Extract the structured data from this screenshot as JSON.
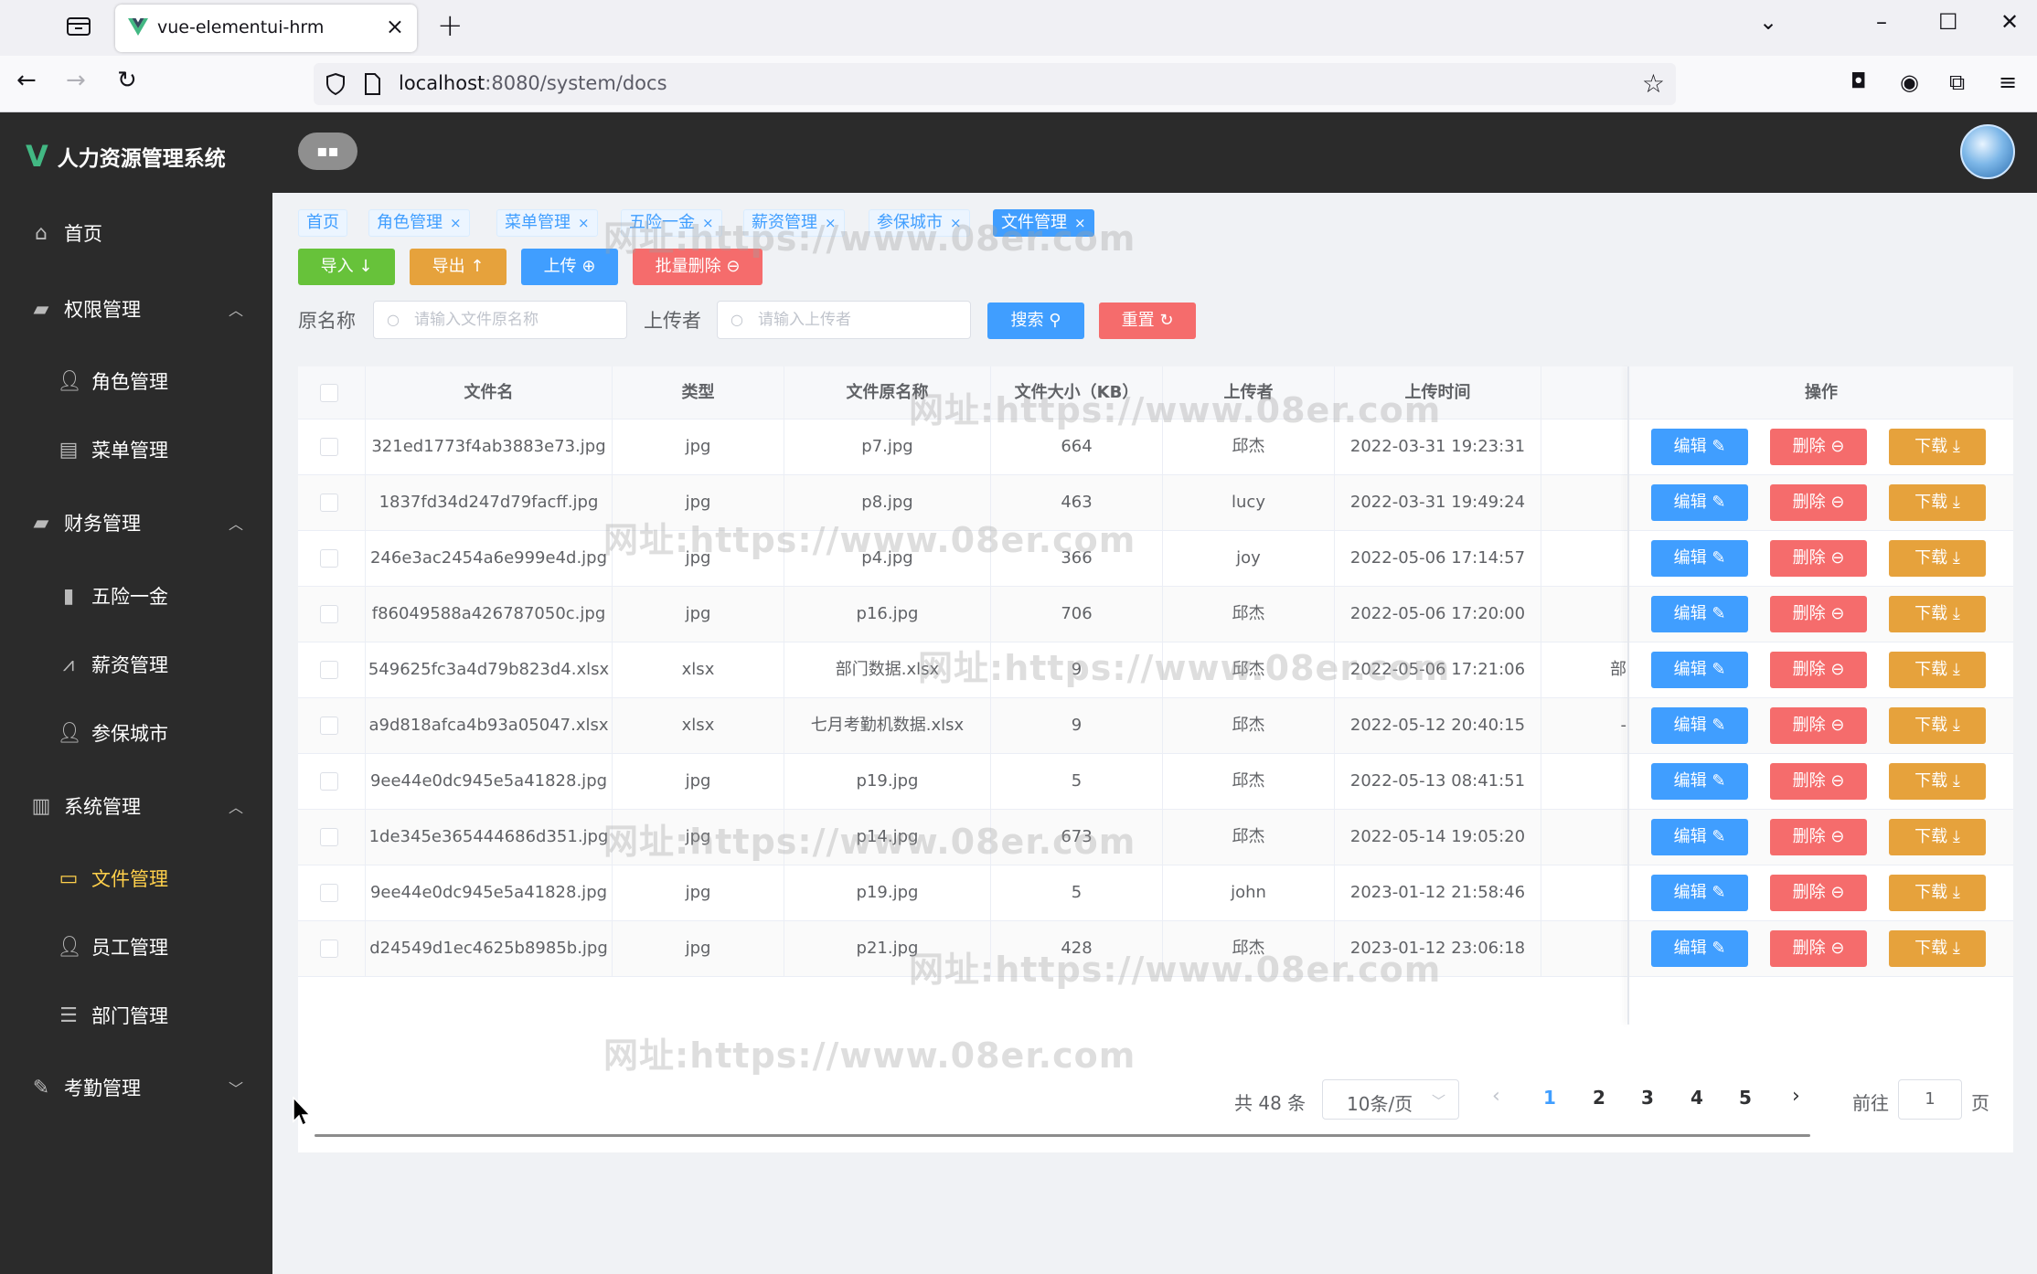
{
  "browser": {
    "tab_title": "vue-elementui-hrm",
    "url_host": "localhost",
    "url_rest": ":8080/system/docs"
  },
  "app": {
    "logo": "V",
    "title": "人力资源管理系统"
  },
  "sidebar": {
    "items": [
      {
        "label": "首页",
        "icon": "home-icon"
      },
      {
        "label": "权限管理",
        "icon": "briefcase-icon"
      },
      {
        "label": "角色管理",
        "icon": "user-icon"
      },
      {
        "label": "菜单管理",
        "icon": "document-icon"
      },
      {
        "label": "财务管理",
        "icon": "wallet-icon"
      },
      {
        "label": "五险一金",
        "icon": "bar-chart-icon"
      },
      {
        "label": "薪资管理",
        "icon": "line-chart-icon"
      },
      {
        "label": "参保城市",
        "icon": "user-icon"
      },
      {
        "label": "系统管理",
        "icon": "folder-icon"
      },
      {
        "label": "文件管理",
        "icon": "folder-open-icon"
      },
      {
        "label": "员工管理",
        "icon": "user-icon"
      },
      {
        "label": "部门管理",
        "icon": "sliders-icon"
      },
      {
        "label": "考勤管理",
        "icon": "edit-icon"
      }
    ]
  },
  "tags": [
    "首页",
    "角色管理",
    "菜单管理",
    "五险一金",
    "薪资管理",
    "参保城市",
    "文件管理"
  ],
  "toolbar": {
    "import": "导入 ↓",
    "export": "导出 ↑",
    "upload": "上传 ⊕",
    "batch_delete": "批量删除 ⊖"
  },
  "search": {
    "name_label": "原名称",
    "name_placeholder": "请输入文件原名称",
    "uploader_label": "上传者",
    "uploader_placeholder": "请输入上传者",
    "search_btn": "搜索 ",
    "reset_btn": "重置 ↻"
  },
  "table": {
    "columns": [
      "文件名",
      "类型",
      "文件原名称",
      "文件大小（KB）",
      "上传者",
      "上传时间",
      "操作"
    ],
    "rows": [
      {
        "name": "321ed1773f4ab3883e73.jpg",
        "type": "jpg",
        "orig": "p7.jpg",
        "size": "664",
        "uploader": "邱杰",
        "time": "2022-03-31 19:23:31",
        "extra": ""
      },
      {
        "name": "1837fd34d247d79facff.jpg",
        "type": "jpg",
        "orig": "p8.jpg",
        "size": "463",
        "uploader": "lucy",
        "time": "2022-03-31 19:49:24",
        "extra": ""
      },
      {
        "name": "246e3ac2454a6e999e4d.jpg",
        "type": "jpg",
        "orig": "p4.jpg",
        "size": "366",
        "uploader": "joy",
        "time": "2022-05-06 17:14:57",
        "extra": ""
      },
      {
        "name": "f86049588a426787050c.jpg",
        "type": "jpg",
        "orig": "p16.jpg",
        "size": "706",
        "uploader": "邱杰",
        "time": "2022-05-06 17:20:00",
        "extra": ""
      },
      {
        "name": "549625fc3a4d79b823d4.xlsx",
        "type": "xlsx",
        "orig": "部门数据.xlsx",
        "size": "9",
        "uploader": "邱杰",
        "time": "2022-05-06 17:21:06",
        "extra": "部"
      },
      {
        "name": "a9d818afca4b93a05047.xlsx",
        "type": "xlsx",
        "orig": "七月考勤机数据.xlsx",
        "size": "9",
        "uploader": "邱杰",
        "time": "2022-05-12 20:40:15",
        "extra": "-"
      },
      {
        "name": "9ee44e0dc945e5a41828.jpg",
        "type": "jpg",
        "orig": "p19.jpg",
        "size": "5",
        "uploader": "邱杰",
        "time": "2022-05-13 08:41:51",
        "extra": ""
      },
      {
        "name": "1de345e365444686d351.jpg",
        "type": "jpg",
        "orig": "p14.jpg",
        "size": "673",
        "uploader": "邱杰",
        "time": "2022-05-14 19:05:20",
        "extra": ""
      },
      {
        "name": "9ee44e0dc945e5a41828.jpg",
        "type": "jpg",
        "orig": "p19.jpg",
        "size": "5",
        "uploader": "john",
        "time": "2023-01-12 21:58:46",
        "extra": ""
      },
      {
        "name": "d24549d1ec4625b8985b.jpg",
        "type": "jpg",
        "orig": "p21.jpg",
        "size": "428",
        "uploader": "邱杰",
        "time": "2023-01-12 23:06:18",
        "extra": ""
      }
    ],
    "actions": {
      "edit": "编辑 ✎",
      "delete": "删除 ⊖",
      "download": "下载 ⤓"
    }
  },
  "pagination": {
    "total": "共 48 条",
    "page_size": "10条/页",
    "pages": [
      "1",
      "2",
      "3",
      "4",
      "5"
    ],
    "current": "1",
    "goto_label": "前往",
    "goto_value": "1",
    "page_suffix": "页"
  },
  "watermark": "网址:https://www.08er.com",
  "colors": {
    "primary": "#409eff",
    "success": "#67c23a",
    "warning": "#e6a23c",
    "danger": "#f56c6c",
    "sidebar": "#2b2b2b",
    "active_menu": "#ffd04b"
  }
}
